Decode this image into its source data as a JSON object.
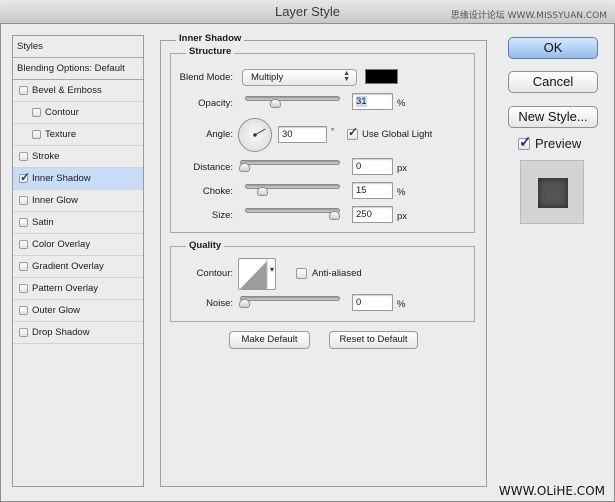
{
  "window": {
    "title": "Layer Style",
    "watermark_top": "思缘设计论坛 WWW.MISSYUAN.COM",
    "watermark_bottom": "WWW.OLiHE.COM"
  },
  "sidebar": {
    "header_items": [
      {
        "label": "Styles"
      },
      {
        "label": "Blending Options: Default"
      }
    ],
    "items": [
      {
        "label": "Bevel & Emboss",
        "checked": false,
        "indent": false,
        "selected": false
      },
      {
        "label": "Contour",
        "checked": false,
        "indent": true,
        "selected": false
      },
      {
        "label": "Texture",
        "checked": false,
        "indent": true,
        "selected": false
      },
      {
        "label": "Stroke",
        "checked": false,
        "indent": false,
        "selected": false
      },
      {
        "label": "Inner Shadow",
        "checked": true,
        "indent": false,
        "selected": true
      },
      {
        "label": "Inner Glow",
        "checked": false,
        "indent": false,
        "selected": false
      },
      {
        "label": "Satin",
        "checked": false,
        "indent": false,
        "selected": false
      },
      {
        "label": "Color Overlay",
        "checked": false,
        "indent": false,
        "selected": false
      },
      {
        "label": "Gradient Overlay",
        "checked": false,
        "indent": false,
        "selected": false
      },
      {
        "label": "Pattern Overlay",
        "checked": false,
        "indent": false,
        "selected": false
      },
      {
        "label": "Outer Glow",
        "checked": false,
        "indent": false,
        "selected": false
      },
      {
        "label": "Drop Shadow",
        "checked": false,
        "indent": false,
        "selected": false
      }
    ]
  },
  "panel": {
    "title": "Inner Shadow",
    "structure": {
      "title": "Structure",
      "blend_mode_label": "Blend Mode:",
      "blend_mode_value": "Multiply",
      "shadow_color": "#000000",
      "opacity_label": "Opacity:",
      "opacity_value": "31",
      "opacity_fraction": 0.31,
      "opacity_unit": "%",
      "angle_label": "Angle:",
      "angle_value": "30",
      "angle_unit": "°",
      "use_global_light_label": "Use Global Light",
      "use_global_light": true,
      "distance_label": "Distance:",
      "distance_value": "0",
      "distance_fraction": 0.0,
      "distance_unit": "px",
      "choke_label": "Choke:",
      "choke_value": "15",
      "choke_fraction": 0.15,
      "choke_unit": "%",
      "size_label": "Size:",
      "size_value": "250",
      "size_fraction": 1.0,
      "size_unit": "px"
    },
    "quality": {
      "title": "Quality",
      "contour_label": "Contour:",
      "anti_aliased_label": "Anti-aliased",
      "anti_aliased": false,
      "noise_label": "Noise:",
      "noise_value": "0",
      "noise_fraction": 0.0,
      "noise_unit": "%"
    },
    "make_default_label": "Make Default",
    "reset_default_label": "Reset to Default"
  },
  "actions": {
    "ok_label": "OK",
    "cancel_label": "Cancel",
    "new_style_label": "New Style...",
    "preview_label": "Preview",
    "preview_checked": true
  }
}
